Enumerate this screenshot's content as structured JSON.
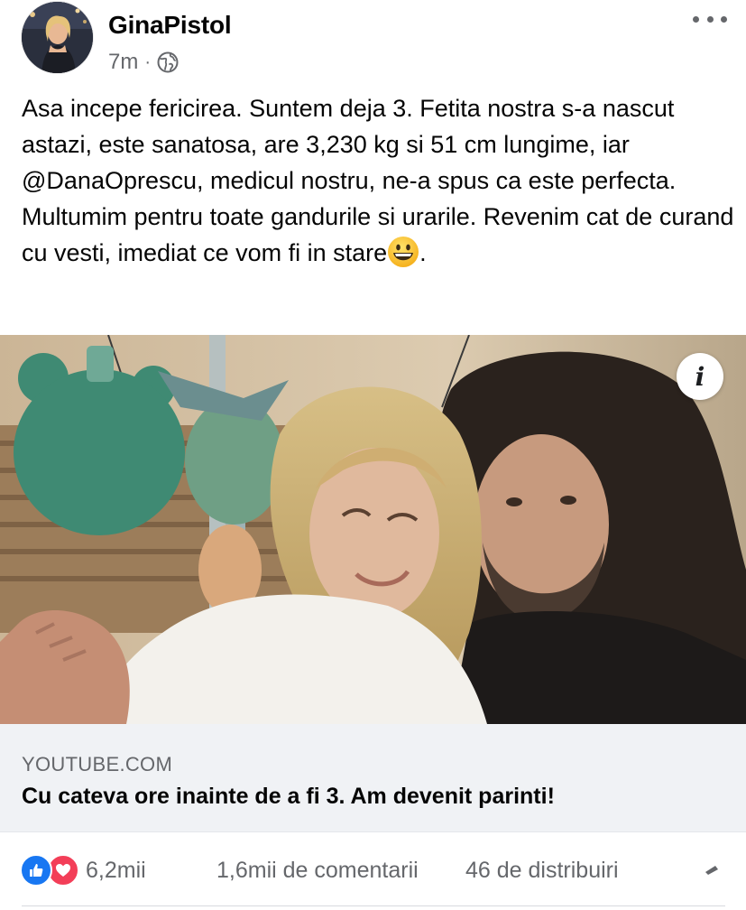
{
  "post": {
    "author": "GinaPistol",
    "time": "7m",
    "separator": "·",
    "privacy_icon": "globe-icon",
    "more_icon": "more-horizontal-icon",
    "text_lines": [
      "Asa incepe fericirea. Suntem deja 3. Fetita nostra s-a nascut astazi, este sanatosa, are 3,230 kg si 51 cm lungime, iar @DanaOprescu, medicul nostru, ne-a spus ca este perfecta.",
      "Multumim pentru toate gandurile si urarile. Revenim cat de curand cu vesti, imediat ce vom fi in stare"
    ],
    "text_end": ".",
    "emoji": "grinning-face-emoji"
  },
  "media": {
    "image_description_icon": "info-icon",
    "info_label": "i"
  },
  "link": {
    "domain": "YOUTUBE.COM",
    "title": "Cu cateva ore inainte de a fi 3. Am devenit parinti!"
  },
  "stats": {
    "reaction_icons": [
      "like-icon",
      "love-icon"
    ],
    "reactions_count": "6,2mii",
    "comments": "1,6mii de comentarii",
    "shares": "46 de distribuiri"
  },
  "colors": {
    "like": "#1877f2",
    "love": "#f33e58",
    "secondary_text": "#65676b",
    "card_bg": "#f0f2f5"
  }
}
